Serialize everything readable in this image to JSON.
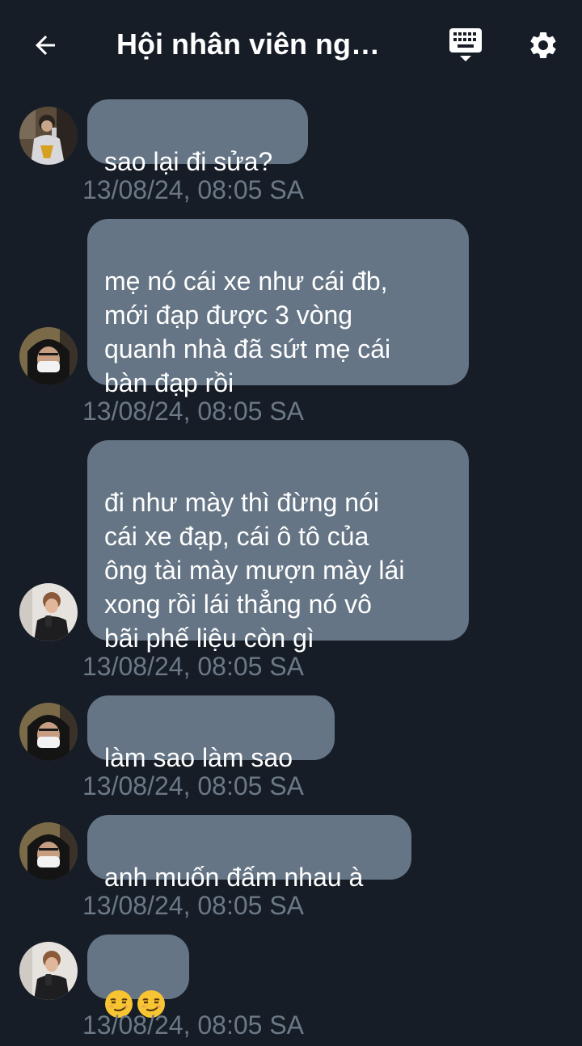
{
  "header": {
    "title": "Hội nhân viên ng…",
    "icons": [
      "back-arrow-icon",
      "keyboard-icon",
      "gear-icon"
    ]
  },
  "messages": [
    {
      "text": "sao lại đi sửa?",
      "timestamp": "13/08/24, 08:05 SA",
      "avatar": "avatar-user-a"
    },
    {
      "text": "mẹ nó cái xe như cái đb,\nmới đạp được 3 vòng\nquanh nhà đã sứt mẹ cái\nbàn đạp rồi",
      "timestamp": "13/08/24, 08:05 SA",
      "avatar": "avatar-user-b"
    },
    {
      "text": "đi như mày thì đừng nói\ncái xe đạp, cái ô tô của\nông tài mày mượn mày lái\nxong rồi lái thẳng nó vô\nbãi phế liệu còn gì",
      "timestamp": "13/08/24, 08:05 SA",
      "avatar": "avatar-user-c"
    },
    {
      "text": "làm sao làm sao",
      "timestamp": "13/08/24, 08:05 SA",
      "avatar": "avatar-user-b"
    },
    {
      "text": "anh muốn đấm nhau à",
      "timestamp": "13/08/24, 08:05 SA",
      "avatar": "avatar-user-b"
    },
    {
      "text": "",
      "emoji": [
        "smirk-emoji",
        "smirk-emoji"
      ],
      "timestamp": "13/08/24, 08:05 SA",
      "avatar": "avatar-user-c"
    }
  ],
  "colors": {
    "background": "#161d27",
    "bubble": "#657585",
    "timestamp": "#6b7886"
  }
}
